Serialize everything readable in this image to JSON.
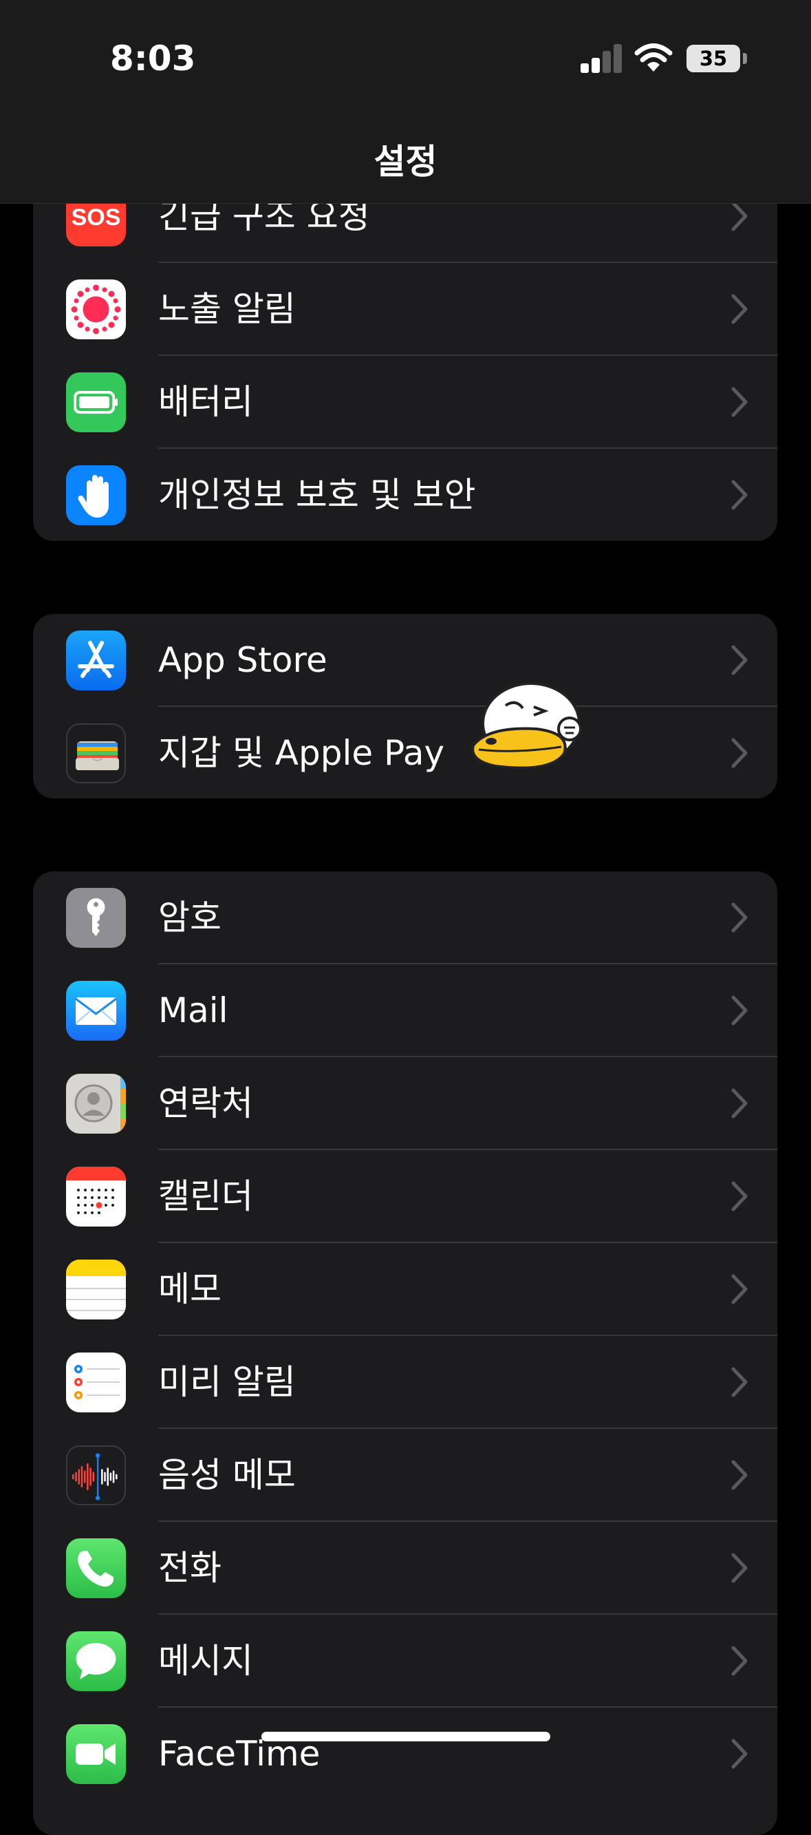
{
  "status_bar": {
    "time": "8:03",
    "battery_level": "35",
    "signal_bars_active": 2,
    "signal_bars_total": 4
  },
  "nav": {
    "title": "설정"
  },
  "groups": [
    {
      "items": [
        {
          "label": "긴급 구조 요청",
          "icon": "sos-icon",
          "icon_text": "SOS",
          "color": "#ff3b30"
        },
        {
          "label": "노출 알림",
          "icon": "exposure-notification-icon",
          "color": "#ffffff"
        },
        {
          "label": "배터리",
          "icon": "battery-icon",
          "color": "#34c759"
        },
        {
          "label": "개인정보 보호 및 보안",
          "icon": "privacy-hand-icon",
          "color": "#0a84ff"
        }
      ]
    },
    {
      "items": [
        {
          "label": "App Store",
          "icon": "app-store-icon",
          "color": "#0a84ff"
        },
        {
          "label": "지갑 및 Apple Pay",
          "icon": "wallet-icon",
          "color": "#1c1c1e"
        }
      ]
    },
    {
      "items": [
        {
          "label": "암호",
          "icon": "key-icon",
          "color": "#8e8e93"
        },
        {
          "label": "Mail",
          "icon": "mail-icon",
          "color": "#1e90ff"
        },
        {
          "label": "연락처",
          "icon": "contacts-icon",
          "color": "#d8d6d0"
        },
        {
          "label": "캘린더",
          "icon": "calendar-icon",
          "color": "#ffffff"
        },
        {
          "label": "메모",
          "icon": "notes-icon",
          "color": "#ffd60a"
        },
        {
          "label": "미리 알림",
          "icon": "reminders-icon",
          "color": "#ffffff"
        },
        {
          "label": "음성 메모",
          "icon": "voice-memos-icon",
          "color": "#1c1c1e"
        },
        {
          "label": "전화",
          "icon": "phone-icon",
          "color": "#34c759"
        },
        {
          "label": "메시지",
          "icon": "messages-icon",
          "color": "#34c759"
        },
        {
          "label": "FaceTime",
          "icon": "facetime-icon",
          "color": "#34c759"
        }
      ]
    }
  ],
  "sticker": {
    "name": "duck-sticker"
  }
}
